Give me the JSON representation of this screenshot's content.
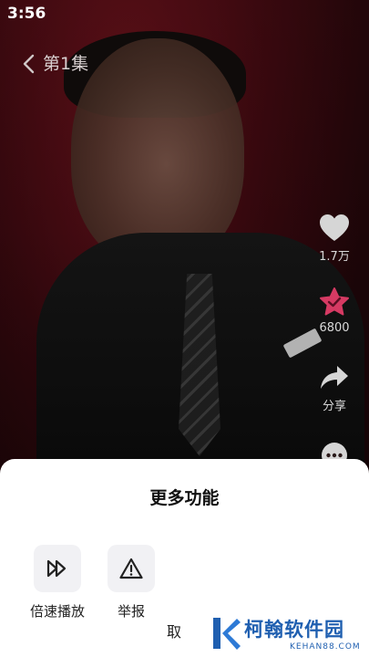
{
  "status_bar": {
    "time": "3:56"
  },
  "nav": {
    "title": "第1集",
    "back_icon": "chevron-left-icon"
  },
  "rail": {
    "like": {
      "icon": "heart-icon",
      "label": "1.7万"
    },
    "collect": {
      "icon": "star-icon",
      "label": "6800",
      "color": "#d63a63"
    },
    "share": {
      "icon": "share-arrow-icon",
      "label": "分享"
    },
    "more": {
      "icon": "more-dots-icon"
    }
  },
  "sheet": {
    "title": "更多功能",
    "actions": [
      {
        "label": "倍速播放",
        "icon": "playback-speed-icon"
      },
      {
        "label": "举报",
        "icon": "report-warning-icon"
      }
    ],
    "cancel_label": "取"
  },
  "watermark": {
    "name": "柯翰软件园",
    "url": "KEHAN88.COM"
  }
}
